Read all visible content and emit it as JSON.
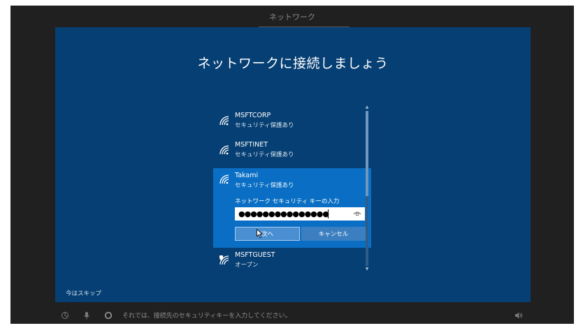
{
  "window": {
    "title": "ネットワーク"
  },
  "page": {
    "heading": "ネットワークに接続しましょう"
  },
  "networks": [
    {
      "name": "MSFTCORP",
      "status": "セキュリティ保護あり",
      "icon": "wifi-secured-icon"
    },
    {
      "name": "MSFTINET",
      "status": "セキュリティ保護あり",
      "icon": "wifi-secured-icon"
    },
    {
      "name": "Takami",
      "status": "セキュリティ保護あり",
      "icon": "wifi-secured-icon",
      "selected": true
    },
    {
      "name": "MSFTGUEST",
      "status": "オープン",
      "icon": "wifi-open-shield-icon"
    }
  ],
  "connect_form": {
    "key_label": "ネットワーク セキュリティ キーの入力",
    "key_value": "●●●●●●●●●●●●●●●",
    "next_label": "次へ",
    "cancel_label": "キャンセル"
  },
  "skip_label": "今はスキップ",
  "taskbar": {
    "narrator_text": "それでは、接続先のセキュリティキーを入力してください。"
  },
  "colors": {
    "panel_bg": "#063f73",
    "selected_bg": "#0a6fc4",
    "frame_bg": "#202020"
  }
}
